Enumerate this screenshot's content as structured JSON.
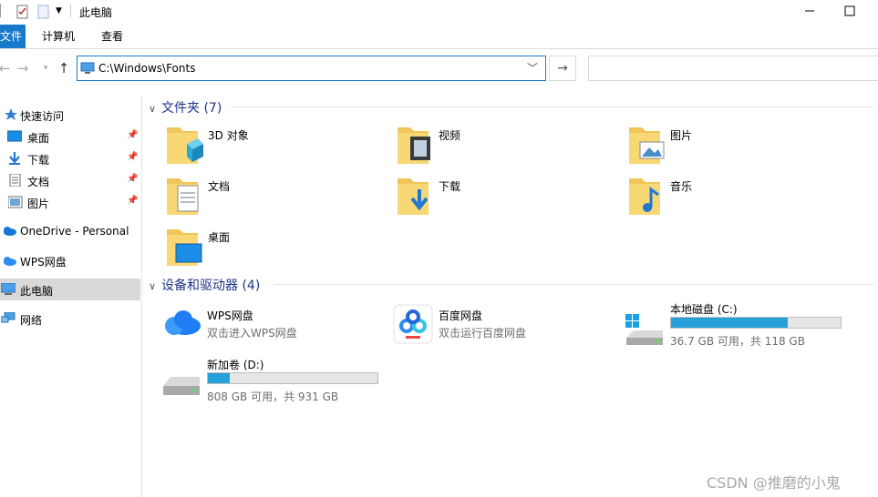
{
  "window": {
    "title": "此电脑",
    "minimize_icon": "minimize-icon",
    "maximize_icon": "maximize-icon"
  },
  "ribbon": {
    "tabs": [
      {
        "label": "文件"
      },
      {
        "label": "计算机"
      },
      {
        "label": "查看"
      }
    ]
  },
  "navigation": {
    "address": "C:\\Windows\\Fonts",
    "search_placeholder": ""
  },
  "sidebar": {
    "items": [
      {
        "label": "快速访问",
        "icon": "star-icon"
      },
      {
        "label": "桌面",
        "icon": "desktop-icon",
        "pinned": true
      },
      {
        "label": "下载",
        "icon": "download-icon",
        "pinned": true
      },
      {
        "label": "文档",
        "icon": "document-icon",
        "pinned": true
      },
      {
        "label": "图片",
        "icon": "picture-icon",
        "pinned": true
      },
      {
        "label": "OneDrive - Personal",
        "icon": "cloud-icon"
      },
      {
        "label": "WPS网盘",
        "icon": "wps-cloud-icon"
      },
      {
        "label": "此电脑",
        "icon": "computer-icon",
        "selected": true
      },
      {
        "label": "网络",
        "icon": "network-icon"
      }
    ]
  },
  "folders_group": {
    "heading": "文件夹 (7)",
    "items": [
      {
        "label": "3D 对象",
        "icon": "3d-objects-folder-icon"
      },
      {
        "label": "视频",
        "icon": "videos-folder-icon"
      },
      {
        "label": "图片",
        "icon": "pictures-folder-icon"
      },
      {
        "label": "文档",
        "icon": "documents-folder-icon"
      },
      {
        "label": "下载",
        "icon": "downloads-folder-icon"
      },
      {
        "label": "音乐",
        "icon": "music-folder-icon"
      },
      {
        "label": "桌面",
        "icon": "desktop-folder-icon"
      }
    ]
  },
  "devices_group": {
    "heading": "设备和驱动器 (4)",
    "items": [
      {
        "name": "WPS网盘",
        "sub": "双击进入WPS网盘",
        "icon": "wps-cloud-drive-icon"
      },
      {
        "name": "百度网盘",
        "sub": "双击运行百度网盘",
        "icon": "baidu-netdisk-icon"
      },
      {
        "name": "本地磁盘 (C:)",
        "sub": "36.7 GB 可用，共 118 GB",
        "icon": "system-drive-icon",
        "used_fraction": 0.69
      },
      {
        "name": "新加卷 (D:)",
        "sub": "808 GB 可用，共 931 GB",
        "icon": "hard-drive-icon",
        "used_fraction": 0.13
      }
    ]
  },
  "watermark": "CSDN @推磨的小鬼",
  "colors": {
    "accent": "#1979ca",
    "bar_fill": "#26a0da",
    "group_heading": "#1e3287"
  }
}
